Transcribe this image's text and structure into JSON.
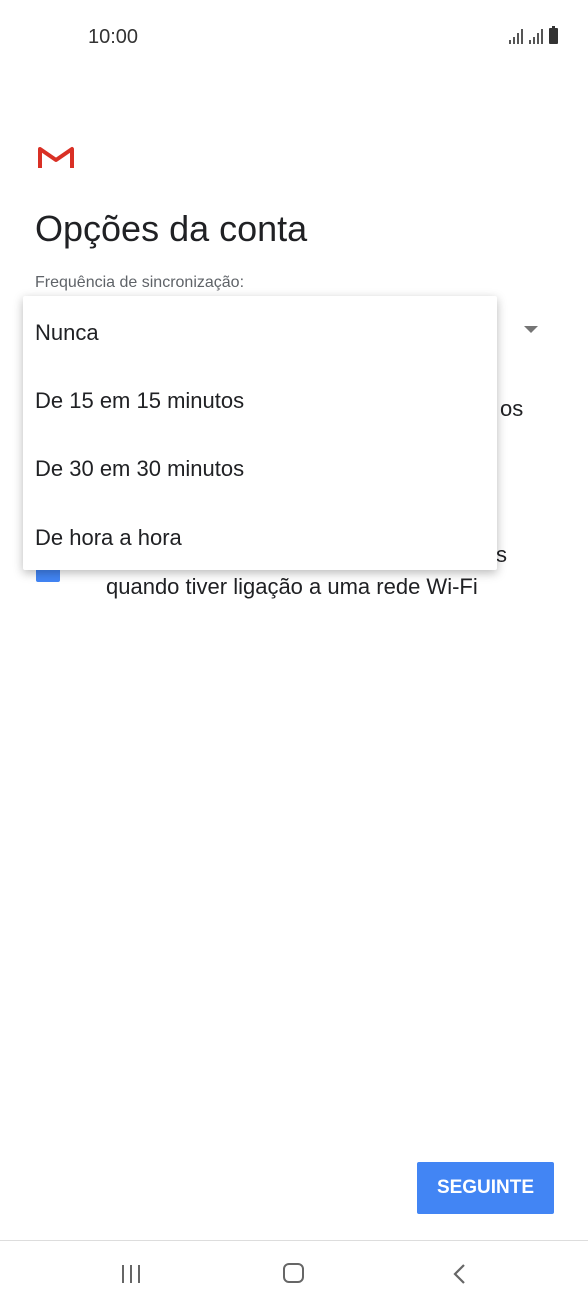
{
  "status_bar": {
    "time": "10:00"
  },
  "page": {
    "title": "Opções da conta",
    "sync_label": "Frequência de sincronização:"
  },
  "sync_menu": {
    "options": [
      "Nunca",
      "De 15 em 15 minutos",
      "De 30 em 30 minutos",
      "De hora a hora"
    ]
  },
  "background": {
    "partial_text_1": "os",
    "partial_text_2": "s",
    "wifi_option_text": "quando tiver ligação a uma rede Wi-Fi"
  },
  "footer": {
    "next_label": "SEGUINTE"
  },
  "colors": {
    "accent": "#4285f4",
    "gmail_red": "#d93025"
  },
  "icons": [
    "signal-icon",
    "battery-icon",
    "gmail-logo-icon",
    "dropdown-arrow-icon",
    "checkbox-icon",
    "recents-icon",
    "home-icon",
    "back-icon"
  ]
}
